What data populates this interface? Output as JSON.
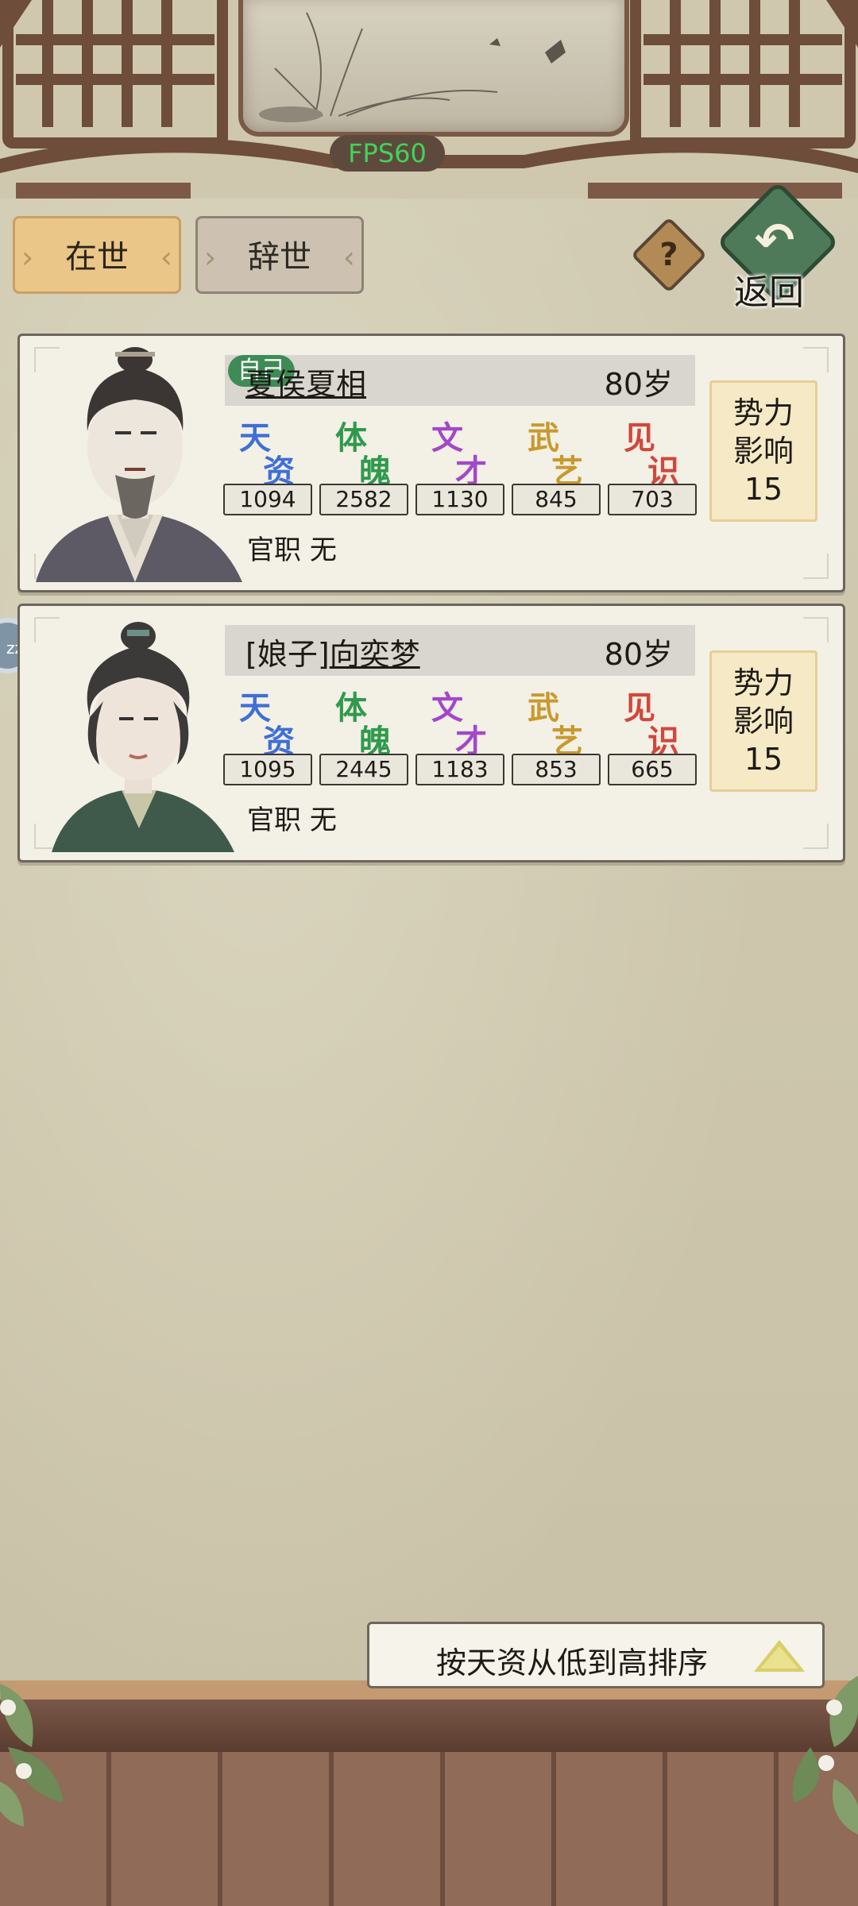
{
  "hud": {
    "fps": "FPS60"
  },
  "tabs": {
    "alive": "在世",
    "deceased": "辞世",
    "active": "alive"
  },
  "help": {
    "label": "?"
  },
  "back": {
    "label": "返回"
  },
  "characters": [
    {
      "name": "夏侯夏相",
      "tag": "自己",
      "age": "80岁",
      "stats": {
        "tianzi": "1094",
        "tipo": "2582",
        "wencai": "1130",
        "wuyi": "845",
        "jianshi": "703"
      },
      "official_label": "官职",
      "official_value": "无",
      "power_line1": "势力",
      "power_line2": "影响",
      "power_value": "15"
    },
    {
      "name_prefix": "[娘子]",
      "name": "向奕梦",
      "age": "80岁",
      "stats": {
        "tianzi": "1095",
        "tipo": "2445",
        "wencai": "1183",
        "wuyi": "853",
        "jianshi": "665"
      },
      "official_label": "官职",
      "official_value": "无",
      "power_line1": "势力",
      "power_line2": "影响",
      "power_value": "15"
    }
  ],
  "stat_labels": {
    "tianzi": [
      "天",
      "资"
    ],
    "tipo": [
      "体",
      "魄"
    ],
    "wencai": [
      "文",
      "才"
    ],
    "wuyi": [
      "武",
      "艺"
    ],
    "jianshi": [
      "见",
      "识"
    ]
  },
  "stat_colors": {
    "tianzi": "#3f6fd6",
    "tipo": "#2f9a4c",
    "wencai": "#a348c8",
    "wuyi": "#c79a2e",
    "jianshi": "#d1473c"
  },
  "sort": {
    "label": "按天资从低到高排序",
    "icon": "triangle-up-icon"
  },
  "side_bubble": {
    "label": "zz"
  }
}
